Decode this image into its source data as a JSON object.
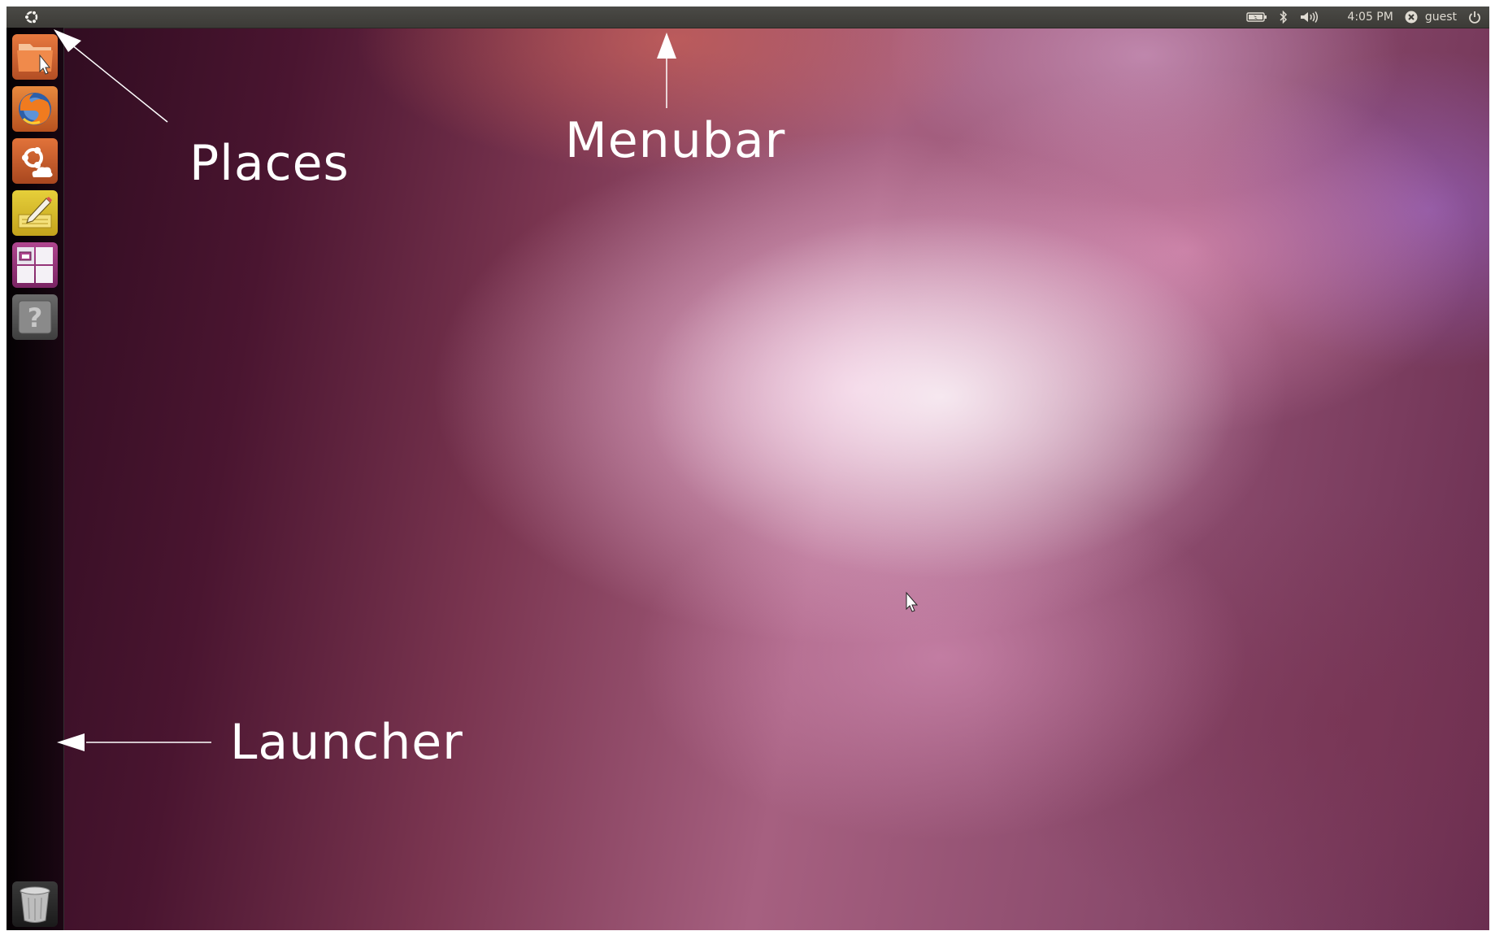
{
  "menubar": {
    "clock": "4:05 PM",
    "user": "guest",
    "icons": {
      "logo": "ubuntu-logo-icon",
      "battery": "battery-icon",
      "bluetooth": "bluetooth-icon",
      "volume": "volume-icon",
      "user_status": "user-status-icon",
      "power": "power-icon"
    }
  },
  "launcher": {
    "items": [
      {
        "icon": "home-folder-icon"
      },
      {
        "icon": "firefox-icon"
      },
      {
        "icon": "ubuntu-one-icon"
      },
      {
        "icon": "text-editor-icon"
      },
      {
        "icon": "workspace-switcher-icon"
      },
      {
        "icon": "help-icon"
      }
    ],
    "trash": {
      "icon": "trash-icon"
    }
  },
  "annotations": {
    "places": "Places",
    "menubar": "Menubar",
    "launcher": "Launcher"
  },
  "colors": {
    "menubar_bg": "#3c3b37",
    "menubar_text": "#dfdbd2",
    "annotation": "#ffffff"
  }
}
